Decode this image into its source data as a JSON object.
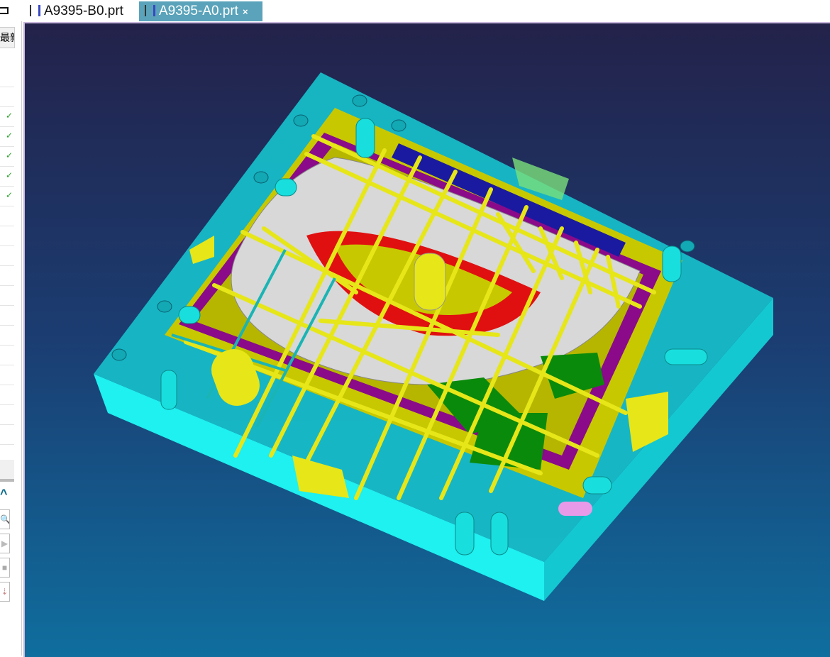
{
  "left_panel": {
    "header_label": "最新",
    "checked_rows": 5,
    "tools": [
      "zoom-icon",
      "arrow-icon",
      "stop-icon",
      "steps-icon"
    ]
  },
  "tabs": [
    {
      "label": "A9395-B0.prt",
      "active": false
    },
    {
      "label": "A9395-A0.prt",
      "active": true,
      "close": "×"
    }
  ],
  "viewport": {
    "background_top": "#23224a",
    "background_bottom": "#0f6e9e",
    "model_colors": {
      "mold_base": "#19e6e6",
      "cooling": "#e6e619",
      "cavity": "#d0d0d0",
      "parting": "#e01010",
      "plate": "#a00090"
    }
  }
}
